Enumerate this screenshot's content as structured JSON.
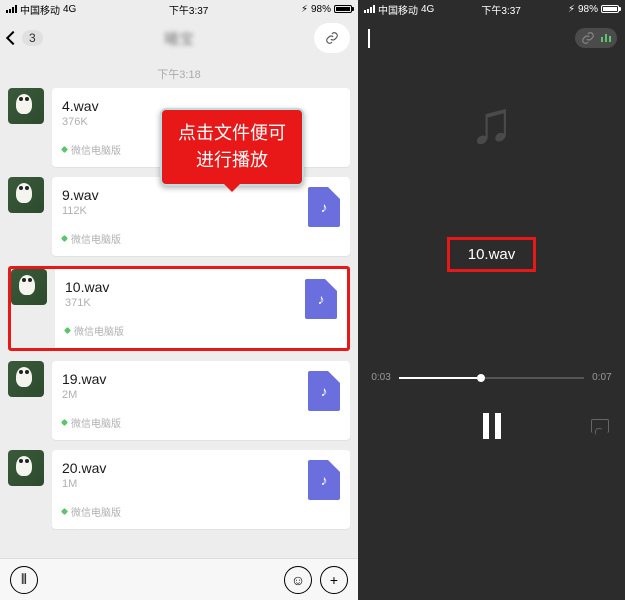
{
  "status": {
    "carrier": "中国移动",
    "net": "4G",
    "time": "下午3:37",
    "batt_icon": "⚡︎",
    "batt": "98%"
  },
  "callout": {
    "line1": "点击文件便可",
    "line2": "进行播放"
  },
  "chat": {
    "back_count": "3",
    "title": "曦宝",
    "time_divider": "下午3:18",
    "messages": [
      {
        "name": "4.wav",
        "size": "376K",
        "src": "微信电脑版"
      },
      {
        "name": "9.wav",
        "size": "112K",
        "src": "微信电脑版"
      },
      {
        "name": "10.wav",
        "size": "371K",
        "src": "微信电脑版"
      },
      {
        "name": "19.wav",
        "size": "2M",
        "src": "微信电脑版"
      },
      {
        "name": "20.wav",
        "size": "1M",
        "src": "微信电脑版"
      }
    ]
  },
  "player": {
    "track": "10.wav",
    "elapsed": "0:03",
    "total": "0:07"
  }
}
